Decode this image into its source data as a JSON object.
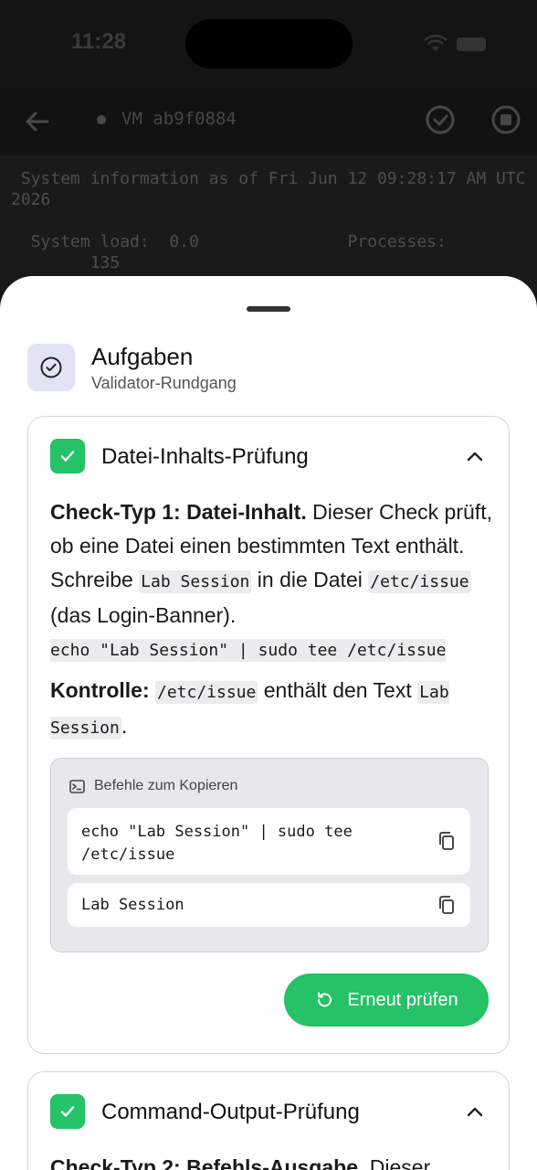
{
  "status": {
    "time": "11:28"
  },
  "terminal_header": {
    "vm_label": "VM ab9f0884"
  },
  "terminal": {
    "text": " System information as of Fri Jun 12 09:28:17 AM UTC 2026\n\n  System load:  0.0               Processes:\n        135"
  },
  "sheet": {
    "title": "Aufgaben",
    "subtitle": "Validator-Rundgang",
    "tasks": [
      {
        "title": "Datei-Inhalts-Prüfung",
        "desc_bold": "Check-Typ 1: Datei-Inhalt.",
        "desc_1": " Dieser Check prüft, ob eine Datei einen bestimmten Text enthält. Schreibe ",
        "code_1": "Lab Session",
        "desc_2": " in die Datei ",
        "code_2": "/etc/issue",
        "desc_3": " (das Login-Banner).",
        "command": "echo \"Lab Session\" | sudo tee /etc/issue",
        "control_bold": "Kontrolle:",
        "control_code_1": "/etc/issue",
        "control_text": " enthält den Text ",
        "control_code_2": "Lab Session",
        "control_end": ".",
        "copy_header": "Befehle zum Kopieren",
        "copy_items": [
          "echo \"Lab Session\" | sudo tee /etc/issue",
          "Lab Session"
        ],
        "retry_label": "Erneut prüfen"
      },
      {
        "title": "Command-Output-Prüfung",
        "desc_bold": "Check-Typ 2: Befehls-Ausgabe.",
        "desc_1": " Dieser"
      }
    ]
  },
  "colors": {
    "accent_green": "#25c267",
    "icon_bg": "#e2e3f4"
  }
}
